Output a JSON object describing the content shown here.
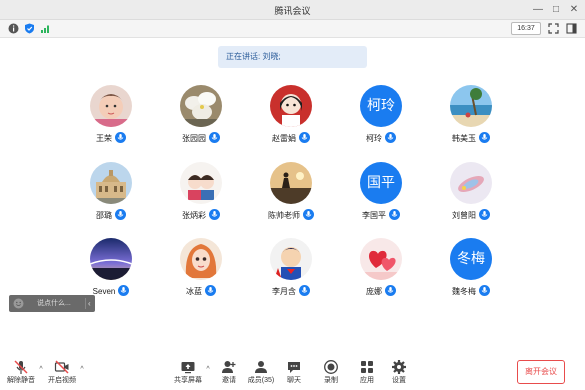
{
  "window": {
    "title": "腾讯会议"
  },
  "infobar": {
    "time": "16:37"
  },
  "speaking": {
    "text": "正在讲话: 刘晓;"
  },
  "participants": [
    {
      "name": "王荣",
      "avatar": "photo-baby"
    },
    {
      "name": "张园园",
      "avatar": "photo-flowers"
    },
    {
      "name": "赵雷娟",
      "avatar": "photo-cartoon-girl"
    },
    {
      "name": "柯玲",
      "avatar_text": "柯玲"
    },
    {
      "name": "韩美玉",
      "avatar": "photo-beach"
    },
    {
      "name": "邵璐",
      "avatar": "photo-building"
    },
    {
      "name": "张炳彩",
      "avatar": "photo-couple-cartoon"
    },
    {
      "name": "陈帅老师",
      "avatar": "photo-sunset-rider"
    },
    {
      "name": "李国平",
      "avatar_text": "国平"
    },
    {
      "name": "刘曾阳",
      "avatar": "photo-candy"
    },
    {
      "name": "Seven",
      "avatar": "photo-aurora"
    },
    {
      "name": "冰蓝",
      "avatar": "photo-cartoon-redhair"
    },
    {
      "name": "李月含",
      "avatar": "photo-superman"
    },
    {
      "name": "庞娜",
      "avatar": "photo-hearts"
    },
    {
      "name": "魏冬梅",
      "avatar_text": "冬梅"
    }
  ],
  "chatbox": {
    "placeholder": "说点什么..."
  },
  "toolbar": {
    "unmute": "解除静音",
    "start_video": "开启视频",
    "share_screen": "共享屏幕",
    "invite": "邀请",
    "members": "成员(35)",
    "chat": "聊天",
    "record": "录制",
    "apps": "应用",
    "settings": "设置",
    "leave": "离开会议"
  },
  "colors": {
    "accent": "#1a7cf0",
    "leave": "#e84c4c"
  }
}
